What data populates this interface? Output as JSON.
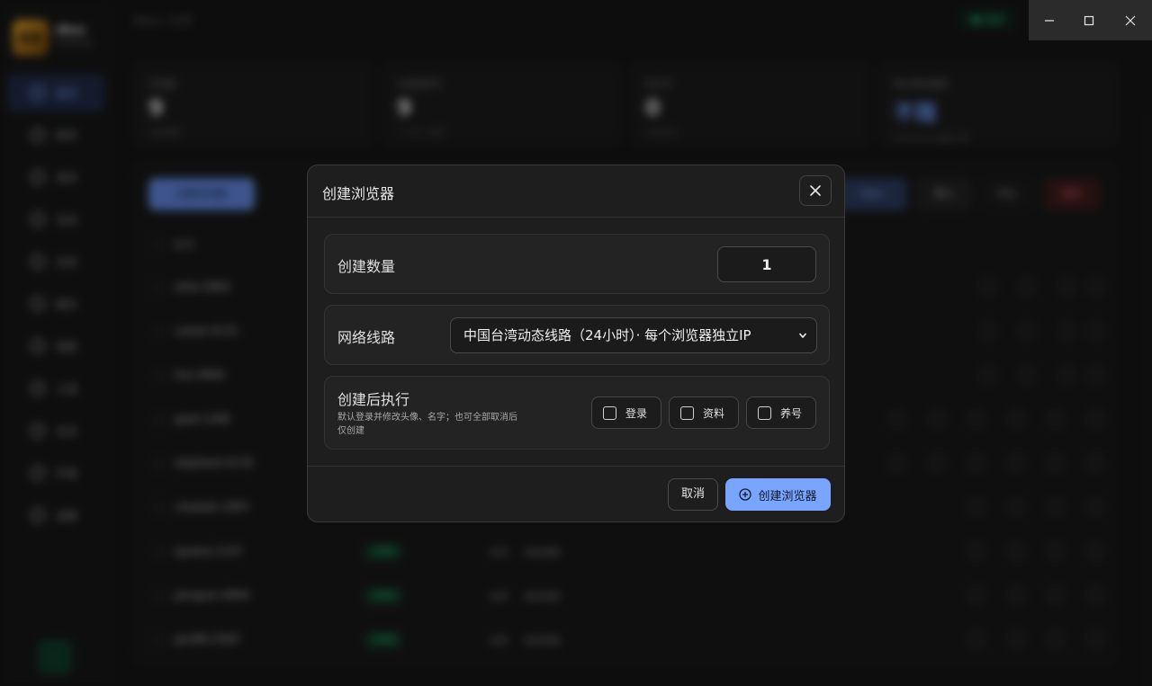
{
  "app": {
    "breadcrumb": "dbox / 主页",
    "connection_status": "● 在线",
    "user": {
      "logo_text": "AK",
      "name": "dbox",
      "sub": "Desktop"
    }
  },
  "sidebar": {
    "items": [
      {
        "label": "首页",
        "active": true
      },
      {
        "label": "账号"
      },
      {
        "label": "发布"
      },
      {
        "label": "互动"
      },
      {
        "label": "任务"
      },
      {
        "label": "聊天"
      },
      {
        "label": "网络"
      },
      {
        "label": "工具"
      },
      {
        "label": "日志"
      },
      {
        "label": "环境"
      },
      {
        "label": "设置"
      }
    ]
  },
  "stats": [
    {
      "label": "浏览器",
      "value": "9",
      "sub": "当前数量"
    },
    {
      "label": "已绑定账号",
      "value": "9",
      "sub": "一个对一绑定"
    },
    {
      "label": "执行中",
      "value": "0",
      "sub": "正在运行"
    },
    {
      "label": "每日剩余额度",
      "value": "不限",
      "sub": "Unlimited 按量计费"
    }
  ],
  "toolbar": {
    "create_label": "创建浏览器",
    "filter_label": "Filter",
    "import_label": "导入",
    "export_label": "导出",
    "delete_label": "删除"
  },
  "table": {
    "header_name": "账号",
    "rows": [
      {
        "name": "otter.2892",
        "status": "",
        "kind": "",
        "region": ""
      },
      {
        "name": "camel.4131",
        "status": "",
        "kind": "",
        "region": ""
      },
      {
        "name": "lion.9964",
        "status": "",
        "kind": "",
        "region": ""
      },
      {
        "name": "goat.1266",
        "status": "",
        "kind": "",
        "region": ""
      },
      {
        "name": "elephant.5170",
        "status": "",
        "kind": "",
        "region": ""
      },
      {
        "name": "cheetah.1997",
        "status": "",
        "kind": "",
        "region": ""
      },
      {
        "name": "iguana.1147",
        "status": "已绑定",
        "kind": "台湾",
        "region": "动态线路"
      },
      {
        "name": "penguin.4694",
        "status": "已绑定",
        "kind": "台湾",
        "region": "动态线路"
      },
      {
        "name": "giraffe.5587",
        "status": "已绑定",
        "kind": "台湾",
        "region": "动态线路"
      }
    ]
  },
  "modal": {
    "title": "创建浏览器",
    "close_icon": "close-icon",
    "quantity": {
      "label": "创建数量",
      "value": "1"
    },
    "network": {
      "label": "网络线路",
      "selected": "中国台湾动态线路（24小时）· 每个浏览器独立IP"
    },
    "post_actions": {
      "label": "创建后执行",
      "hint": "默认登录并修改头像、名字；也可全部取消后仅创建",
      "options": [
        {
          "label": "登录",
          "checked": false
        },
        {
          "label": "资料",
          "checked": false
        },
        {
          "label": "养号",
          "checked": false
        }
      ]
    },
    "cancel_label": "取消",
    "create_label": "创建浏览器"
  },
  "colors": {
    "accent": "#7aa5ff",
    "success": "#2dbd78",
    "danger": "#e05555",
    "modal_bg": "#1e1e1e"
  }
}
